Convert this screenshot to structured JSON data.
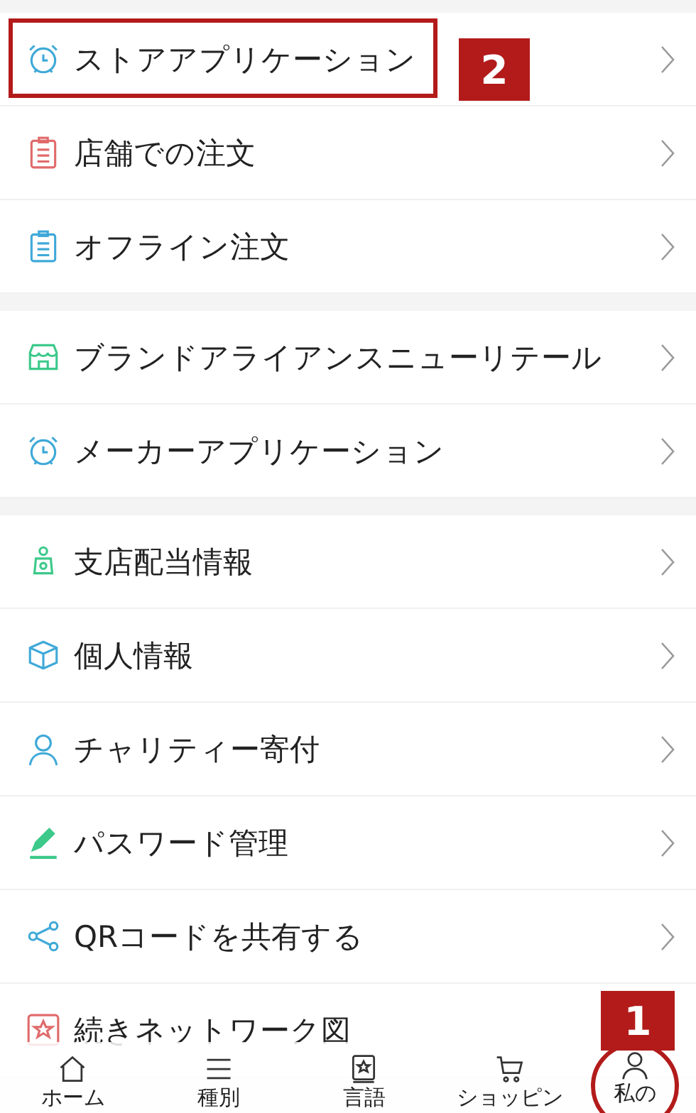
{
  "menu_groups": [
    {
      "items": [
        {
          "label": "ストアアプリケーション",
          "kind": "clock",
          "color": "#3fa9d8",
          "highlighted": true,
          "callout": "2"
        },
        {
          "label": "店舗での注文",
          "kind": "clipboard",
          "color": "#e06b6b",
          "highlighted": false
        },
        {
          "label": "オフライン注文",
          "kind": "clipboard",
          "color": "#3fa9d8",
          "highlighted": false
        }
      ]
    },
    {
      "items": [
        {
          "label": "ブランドアライアンスニューリテール",
          "kind": "store",
          "color": "#3cc98a",
          "highlighted": false
        },
        {
          "label": "メーカーアプリケーション",
          "kind": "clock",
          "color": "#3fa9d8",
          "highlighted": false
        }
      ]
    },
    {
      "items": [
        {
          "label": "支店配当情報",
          "kind": "pot",
          "color": "#3cc98a",
          "highlighted": false
        },
        {
          "label": "個人情報",
          "kind": "box",
          "color": "#3fa9d8",
          "highlighted": false
        },
        {
          "label": "チャリティー寄付",
          "kind": "person",
          "color": "#3fa9d8",
          "highlighted": false
        },
        {
          "label": "パスワード管理",
          "kind": "pencil",
          "color": "#3cc98a",
          "highlighted": false
        },
        {
          "label": "QRコードを共有する",
          "kind": "share",
          "color": "#3fa9d8",
          "highlighted": false
        },
        {
          "label": "続きネットワーク図",
          "kind": "star",
          "color": "#e06b6b",
          "highlighted": false
        }
      ]
    }
  ],
  "tab_bar": [
    {
      "label": "ホーム",
      "kind": "home",
      "highlighted": false
    },
    {
      "label": "種別",
      "kind": "menu",
      "highlighted": false
    },
    {
      "label": "言語",
      "kind": "book",
      "highlighted": false
    },
    {
      "label": "ショッピン",
      "kind": "cart",
      "highlighted": false
    },
    {
      "label": "私の",
      "kind": "person",
      "highlighted": true,
      "callout": "1"
    }
  ]
}
